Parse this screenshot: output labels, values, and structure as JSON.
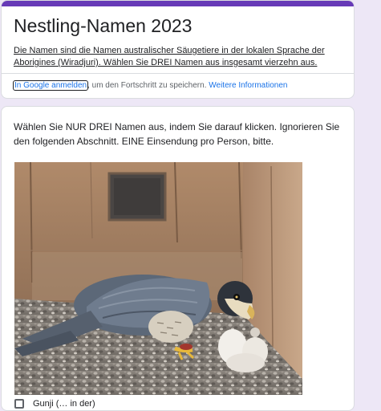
{
  "header": {
    "title": "Nestling-Namen 2023",
    "description": "Die Namen sind die Namen australischer Säugetiere in der lokalen Sprache der Aborigines (Wiradjuri). Wählen Sie DREI Namen aus insgesamt vierzehn aus.",
    "signin_link": "In Google anmelden",
    "signin_rest": ", um den Fortschritt zu speichern.",
    "more_info_link": "Weitere Informationen",
    "accent_color": "#673ab7"
  },
  "question": {
    "text": "Wählen Sie NUR DREI Namen aus, indem Sie darauf klicken. Ignorieren Sie den folgenden Abschnitt. EINE Einsendung pro Person, bitte.",
    "option_label": "Gunji (… in der)"
  }
}
